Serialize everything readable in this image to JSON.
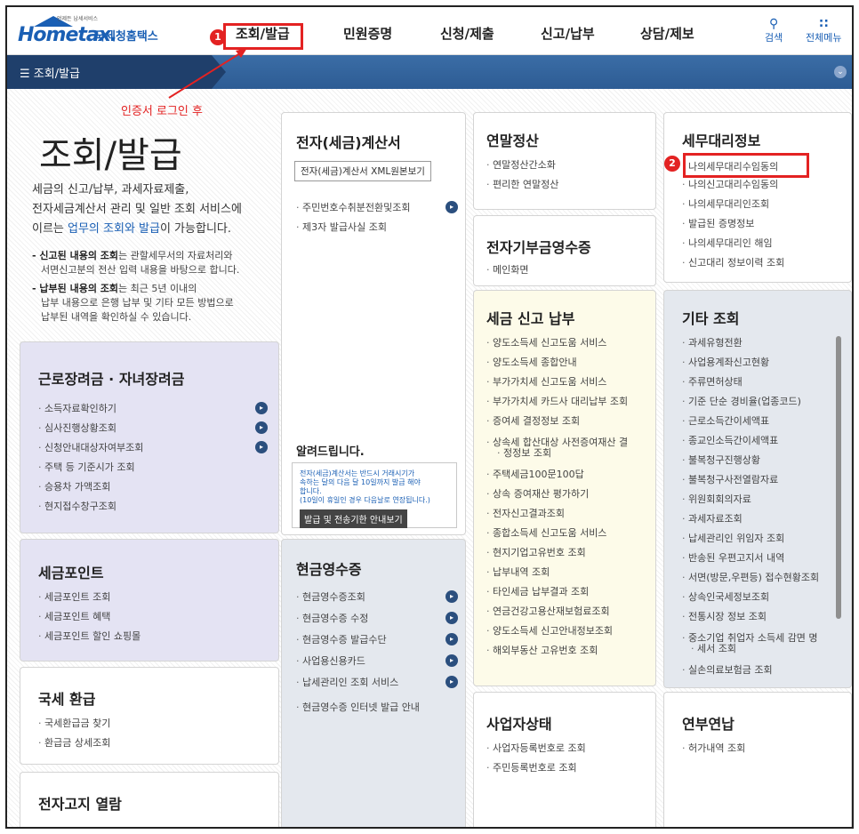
{
  "header": {
    "logo_tagline": "언제든 납세서비스",
    "logo_text": "Hometax.",
    "logo_kr": "국세청홈택스",
    "nav": [
      "조회/발급",
      "민원증명",
      "신청/제출",
      "신고/납부",
      "상담/제보"
    ],
    "search_label": "검색",
    "menu_label": "전체메뉴"
  },
  "markers": {
    "m1": "1",
    "m2": "2"
  },
  "subnav": {
    "label": "조회/발급"
  },
  "annotation": "인증서 로그인 후",
  "hero": {
    "title": "조회/발급",
    "desc1": "세금의 신고/납부, 과세자료제출,",
    "desc2": "전자세금계산서 관리 및 일반 조회 서비스에",
    "desc3a": "이르는 ",
    "desc3b": "업무의 조회와 발급",
    "desc3c": "이 가능합니다.",
    "note1a": "- 신고된 내용의 조회",
    "note1b": "는 관할세무서의 자료처리와",
    "note1c": "서면신고분의 전산 입력 내용을 바탕으로 합니다.",
    "note2a": "- 납부된 내용의 조회",
    "note2b": "는 최근 5년 이내의",
    "note2c": "납부 내용으로 은행 납부 및 기타 모든 방법으로",
    "note2d": "납부된 내역을 확인하실 수 있습니다."
  },
  "cards": {
    "tax_invoice": {
      "title": "전자(세금)계산서",
      "button": "전자(세금)계산서 XML원본보기",
      "items": [
        "주민번호수취분전환및조회",
        "제3자 발급사실 조회"
      ]
    },
    "notice": {
      "title": "알려드립니다.",
      "line1": "전자(세금)계산서는 반드시 거래시기가",
      "line2": "속하는 달의 다음 달 10일까지 발급 해야",
      "line3": "합니다.",
      "line4": "(10일이 휴일인 경우 다음날로 연장됩니다.)",
      "button": "발급 및 전송기한 안내보기"
    },
    "year_end": {
      "title": "연말정산",
      "items": [
        "연말정산간소화",
        "편리한 연말정산"
      ]
    },
    "donation": {
      "title": "전자기부금영수증",
      "items": [
        "메인화면"
      ]
    },
    "agent": {
      "title": "세무대리정보",
      "items": [
        "나의세무대리수임동의",
        "나의신고대리수임동의",
        "나의세무대리인조회",
        "발급된 증명정보",
        "나의세무대리인 해임",
        "신고대리 정보이력 조회"
      ]
    },
    "work_incentive": {
      "title": "근로장려금 · 자녀장려금",
      "items": [
        "소득자료확인하기",
        "심사진행상황조회",
        "신청안내대상자여부조회",
        "주택 등 기준시가 조회",
        "승용차 가액조회",
        "현지접수창구조회"
      ]
    },
    "tax_report": {
      "title": "세금 신고 납부",
      "items": [
        "양도소득세 신고도움 서비스",
        "양도소득세 종합안내",
        "부가가치세 신고도움 서비스",
        "부가가치세 카드사 대리납부 조회",
        "증여세 결정정보 조회",
        "상속세 합산대상 사전증여재산 결",
        "정정보 조회",
        "주택세금100문100답",
        "상속 증여재산 평가하기",
        "전자신고결과조회",
        "종합소득세 신고도움 서비스",
        "현지기업고유번호 조회",
        "납부내역 조회",
        "타인세금 납부결과 조회",
        "연금건강고용산재보험료조회",
        "양도소득세 신고안내정보조회",
        "해외부동산 고유번호 조회"
      ]
    },
    "etc": {
      "title": "기타 조회",
      "items": [
        "과세유형전환",
        "사업용계좌신고현황",
        "주류면허상태",
        "기준 단순 경비율(업종코드)",
        "근로소득간이세액표",
        "종교인소득간이세액표",
        "불복청구진행상황",
        "불복청구사전열람자료",
        "위원회회의자료",
        "과세자료조회",
        "납세관리인 위임자 조회",
        "반송된 우편고지서 내역",
        "서면(방문,우편등) 접수현황조회",
        "상속인국세정보조회",
        "전통시장 정보 조회",
        "중소기업 취업자 소득세 감면 명",
        "세서 조회",
        "실손의료보험금 조회"
      ]
    },
    "tax_point": {
      "title": "세금포인트",
      "items": [
        "세금포인트 조회",
        "세금포인트 혜택",
        "세금포인트 할인 쇼핑몰"
      ]
    },
    "cash_receipt": {
      "title": "현금영수증",
      "items": [
        "현금영수증조회",
        "현금영수증 수정",
        "현금영수증 발급수단",
        "사업용신용카드",
        "납세관리인 조회 서비스",
        "현금영수증 인터넷 발급 안내"
      ]
    },
    "refund": {
      "title": "국세 환급",
      "items": [
        "국세환급금 찾기",
        "환급금 상세조회"
      ]
    },
    "business": {
      "title": "사업자상태",
      "items": [
        "사업자등록번호로 조회",
        "주민등록번호로 조회"
      ]
    },
    "license": {
      "title": "연부연납",
      "items": [
        "허가내역 조회"
      ]
    },
    "e_notice": {
      "title": "전자고지 열람"
    }
  }
}
